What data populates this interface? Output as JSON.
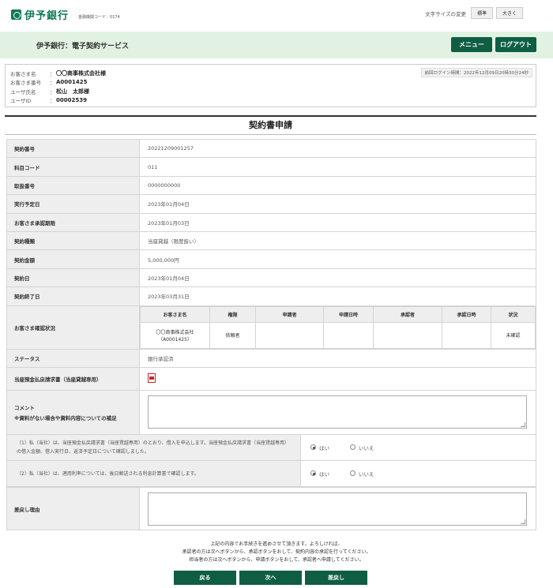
{
  "header": {
    "logo_text": "伊予銀行",
    "institution_code": "金融機関コード：0174",
    "font_size_label": "文字サイズの変更",
    "font_size_standard": "標準",
    "font_size_large": "大きく"
  },
  "service_bar": {
    "title": "伊予銀行：電子契約サービス",
    "menu_label": "メニュー",
    "logout_label": "ログアウト"
  },
  "customer": {
    "rows": [
      {
        "label": "お客さま名",
        "value": "〇〇商事株式会社様"
      },
      {
        "label": "お客さま番号",
        "value": "A0001425"
      },
      {
        "label": "ユーザ氏名",
        "value": "松山　太郎様"
      },
      {
        "label": "ユーザID",
        "value": "00002539"
      }
    ],
    "separator": "：",
    "last_login": "前回ログイン時間：2022年12月09日20時30分24秒"
  },
  "page_title": "契約書申請",
  "details": {
    "contract_no": {
      "label": "契約番号",
      "value": "20221209001257"
    },
    "subject_code": {
      "label": "科目コード",
      "value": "011"
    },
    "transaction_no": {
      "label": "取扱番号",
      "value": "0000000000"
    },
    "execution_date": {
      "label": "実行予定日",
      "value": "2023年01月04日"
    },
    "approval_deadline": {
      "label": "お客さま承認期限",
      "value": "2023年01月03日"
    },
    "contract_type": {
      "label": "契約種類",
      "value": "当座貸越（限度扱い）"
    },
    "contract_amount": {
      "label": "契約金額",
      "value": "5,000,000円"
    },
    "contract_date": {
      "label": "契約日",
      "value": "2023年01月04日"
    },
    "contract_end_date": {
      "label": "契約終了日",
      "value": "2023年03月31日"
    },
    "confirmation_status": {
      "label": "お客さま確認状況",
      "headers": [
        "お客さま名",
        "権限",
        "申請者",
        "申請日時",
        "承認者",
        "承認日時",
        "状況"
      ],
      "row": {
        "customer_name": "〇〇商事株式会社",
        "customer_number": "（A0001425）",
        "authority": "依頼者",
        "applicant": "",
        "applied_at": "",
        "approver": "",
        "approved_at": "",
        "status": "未確認"
      }
    },
    "status": {
      "label": "ステータス",
      "value": "銀行承認済"
    },
    "document": {
      "label": "当座預金払戻請求書（当座貸越専用）",
      "icon": "pdf-icon"
    },
    "comment": {
      "label": "コメント",
      "note": "※資料がない場合や資料内容についての補足",
      "value": ""
    }
  },
  "confirmations": [
    {
      "text": "（1）私（当社）は、当座預金払戻請求書（当座貸越専用）のとおり、借入を申込します。当座預金払戻請求書（当座貸越専用）の借入金額、借入実行日、返済予定日について確認しました。",
      "yes": "はい",
      "no": "いいえ",
      "selected": "yes"
    },
    {
      "text": "（2）私（当社）は、適用利率については、後日郵送される利息計算書で確認します。",
      "yes": "はい",
      "no": "いいえ",
      "selected": "yes"
    }
  ],
  "return_reason": {
    "label": "差戻し理由",
    "value": ""
  },
  "notes": [
    "上記の内容でお手続きを進めさせて頂きます。よろしければ、",
    "承認者の方は次へボタンから、承認ボタンをおして、契約内容の承認を行ってください。",
    "担当者の方は次へボタンから、申請ボタンをおして、承認者へ申請してください。"
  ],
  "footer_buttons": {
    "back": "戻る",
    "next": "次へ",
    "return": "差戻し"
  },
  "colors": {
    "brand_green": "#0f7a52",
    "button_green": "#0f5e44",
    "service_bar_bg": "#e1f2e2"
  }
}
